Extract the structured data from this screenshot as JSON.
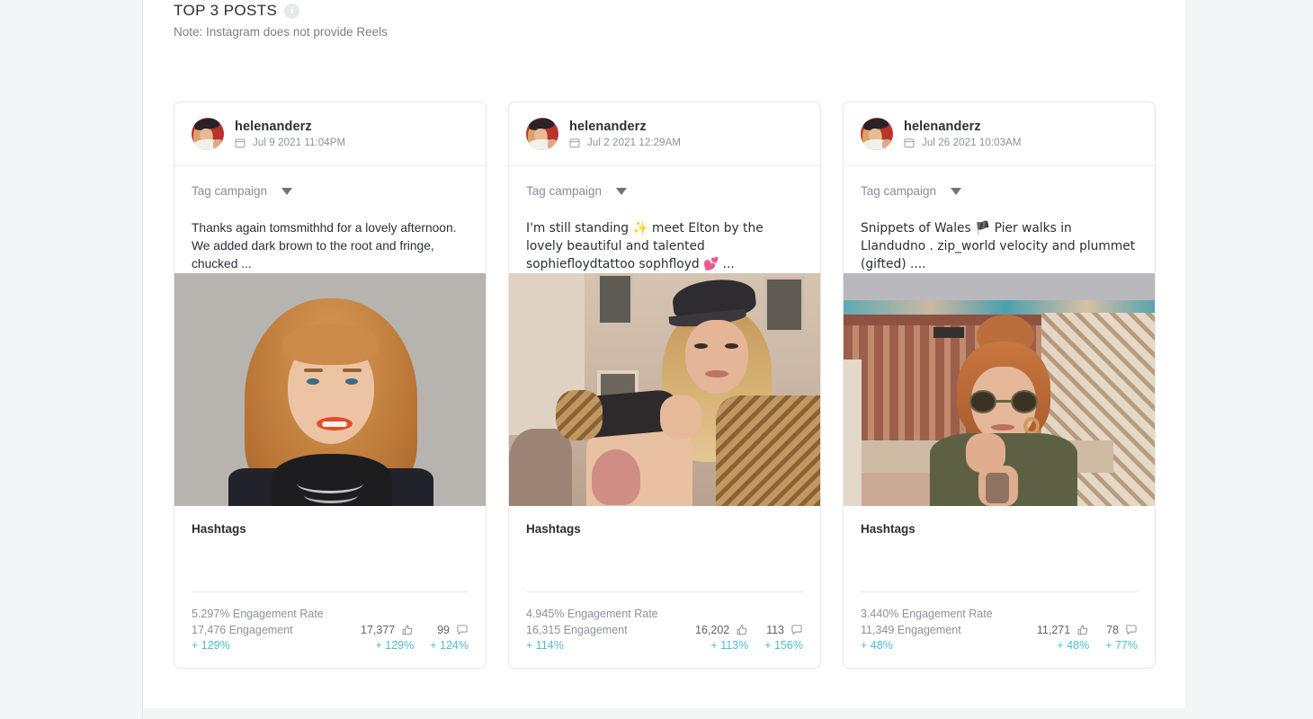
{
  "header": {
    "title": "TOP 3 POSTS",
    "info_icon": "info-icon",
    "note": "Note: Instagram does not provide Reels"
  },
  "labels": {
    "tag_campaign": "Tag campaign",
    "hashtags": "Hashtags",
    "engagement_rate_suffix": "Engagement Rate",
    "engagement_suffix": "Engagement",
    "like_icon": "thumbs-up-icon",
    "comment_icon": "comment-bubble-icon",
    "calendar_icon": "calendar-icon",
    "caret_icon": "chevron-down-icon"
  },
  "colors": {
    "accent_delta": "#4dbec7",
    "page_background": "#f4f5f7",
    "panel_background": "#ffffff",
    "card_border": "#e6e7eb",
    "muted_text": "#8d9199",
    "primary_text": "#2b2e38"
  },
  "posts": [
    {
      "username": "helenanderz",
      "date": "Jul 9 2021 11:04PM",
      "caption": "Thanks again tomsmithhd for a lovely afternoon. We added dark brown to the root and fringe, chucked ...",
      "engagement_rate": "5.297% Engagement Rate",
      "engagement": "17,476 Engagement",
      "engagement_delta": "+ 129%",
      "likes": "17,377",
      "likes_delta": "+ 129%",
      "comments": "99",
      "comments_delta": "+ 124%"
    },
    {
      "username": "helenanderz",
      "date": "Jul 2 2021 12:29AM",
      "caption": "I'm still standing ✨ meet Elton by the lovely beautiful and talented sophiefloydtattoo sophfloyd 💕 ...",
      "engagement_rate": "4.945% Engagement Rate",
      "engagement": "16,315 Engagement",
      "engagement_delta": "+ 114%",
      "likes": "16,202",
      "likes_delta": "+ 113%",
      "comments": "113",
      "comments_delta": "+ 156%"
    },
    {
      "username": "helenanderz",
      "date": "Jul 26 2021 10:03AM",
      "caption": "Snippets of Wales 🏴 Pier walks in Llandudno . zip_world velocity and plummet (gifted) ....",
      "engagement_rate": "3.440% Engagement Rate",
      "engagement": "11,349 Engagement",
      "engagement_delta": "+ 48%",
      "likes": "11,271",
      "likes_delta": "+ 48%",
      "comments": "78",
      "comments_delta": "+ 77%"
    }
  ]
}
